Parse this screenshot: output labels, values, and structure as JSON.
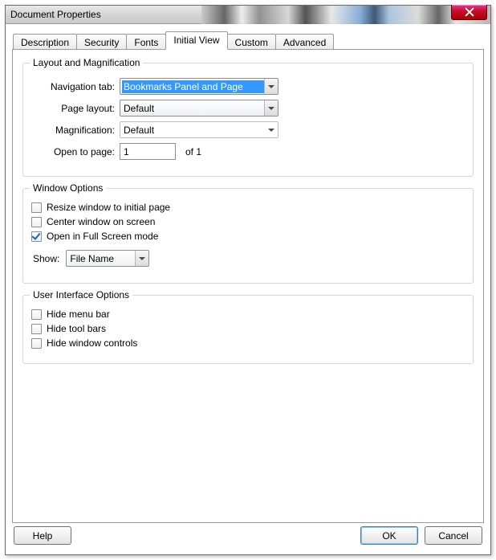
{
  "window": {
    "title": "Document Properties"
  },
  "tabs": {
    "description": "Description",
    "security": "Security",
    "fonts": "Fonts",
    "initial_view": "Initial View",
    "custom": "Custom",
    "advanced": "Advanced"
  },
  "layout_mag": {
    "legend": "Layout and Magnification",
    "nav_tab_label": "Navigation tab:",
    "nav_tab_value": "Bookmarks Panel and Page",
    "page_layout_label": "Page layout:",
    "page_layout_value": "Default",
    "magnification_label": "Magnification:",
    "magnification_value": "Default",
    "open_to_page_label": "Open to page:",
    "open_to_page_value": "1",
    "of_pages": "of 1"
  },
  "window_options": {
    "legend": "Window Options",
    "resize": "Resize window to initial page",
    "resize_checked": false,
    "center": "Center window on screen",
    "center_checked": false,
    "fullscreen": "Open in Full Screen mode",
    "fullscreen_checked": true,
    "show_label": "Show:",
    "show_value": "File Name"
  },
  "ui_options": {
    "legend": "User Interface Options",
    "hide_menu": "Hide menu bar",
    "hide_menu_checked": false,
    "hide_tool": "Hide tool bars",
    "hide_tool_checked": false,
    "hide_ctrls": "Hide window controls",
    "hide_ctrls_checked": false
  },
  "buttons": {
    "help": "Help",
    "ok": "OK",
    "cancel": "Cancel"
  }
}
